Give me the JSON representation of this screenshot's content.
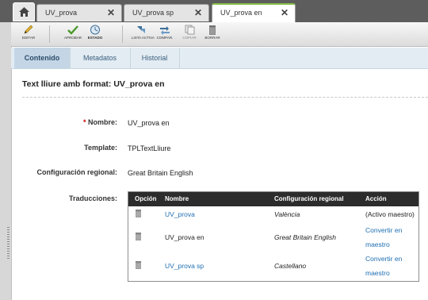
{
  "tabs": {
    "home_icon": "home-icon",
    "items": [
      {
        "label": "UV_prova"
      },
      {
        "label": "UV_prova sp"
      },
      {
        "label": "UV_prova en"
      }
    ]
  },
  "toolbar": {
    "editar": "EDITAR",
    "aprobar": "APROBAR",
    "estado": "ESTADO",
    "lista_activa": "LISTA ACTIVA",
    "comparar": "COMPAR.",
    "copiar": "COPIAR",
    "borrar": "BORRAR"
  },
  "subtabs": [
    "Contenido",
    "Metadatos",
    "Historial"
  ],
  "title": "Text lliure amb format:  UV_prova en",
  "fields": {
    "nombre_label": "Nombre:",
    "nombre_value": "UV_prova en",
    "template_label": "Template:",
    "template_value": "TPLTextLliure",
    "config_label": "Configuración regional:",
    "config_value": "Great Britain English",
    "traducciones_label": "Traducciones:"
  },
  "translations": {
    "headers": [
      "Opción",
      "Nombre",
      "Configuración regional",
      "Acción"
    ],
    "rows": [
      {
        "name": "UV_prova",
        "locale": "València",
        "action_line1": "(Activo maestro)",
        "action_line2": ""
      },
      {
        "name": "UV_prova en",
        "locale": "Great Britain English",
        "action_line1": "Convertir en",
        "action_line2": "maestro"
      },
      {
        "name": "UV_prova sp",
        "locale": "Castellano",
        "action_line1": "Convertir en",
        "action_line2": "maestro"
      }
    ]
  },
  "colors": {
    "accent_green": "#86bd47",
    "link_blue": "#1f6fb2",
    "required_red": "#cc0000"
  }
}
